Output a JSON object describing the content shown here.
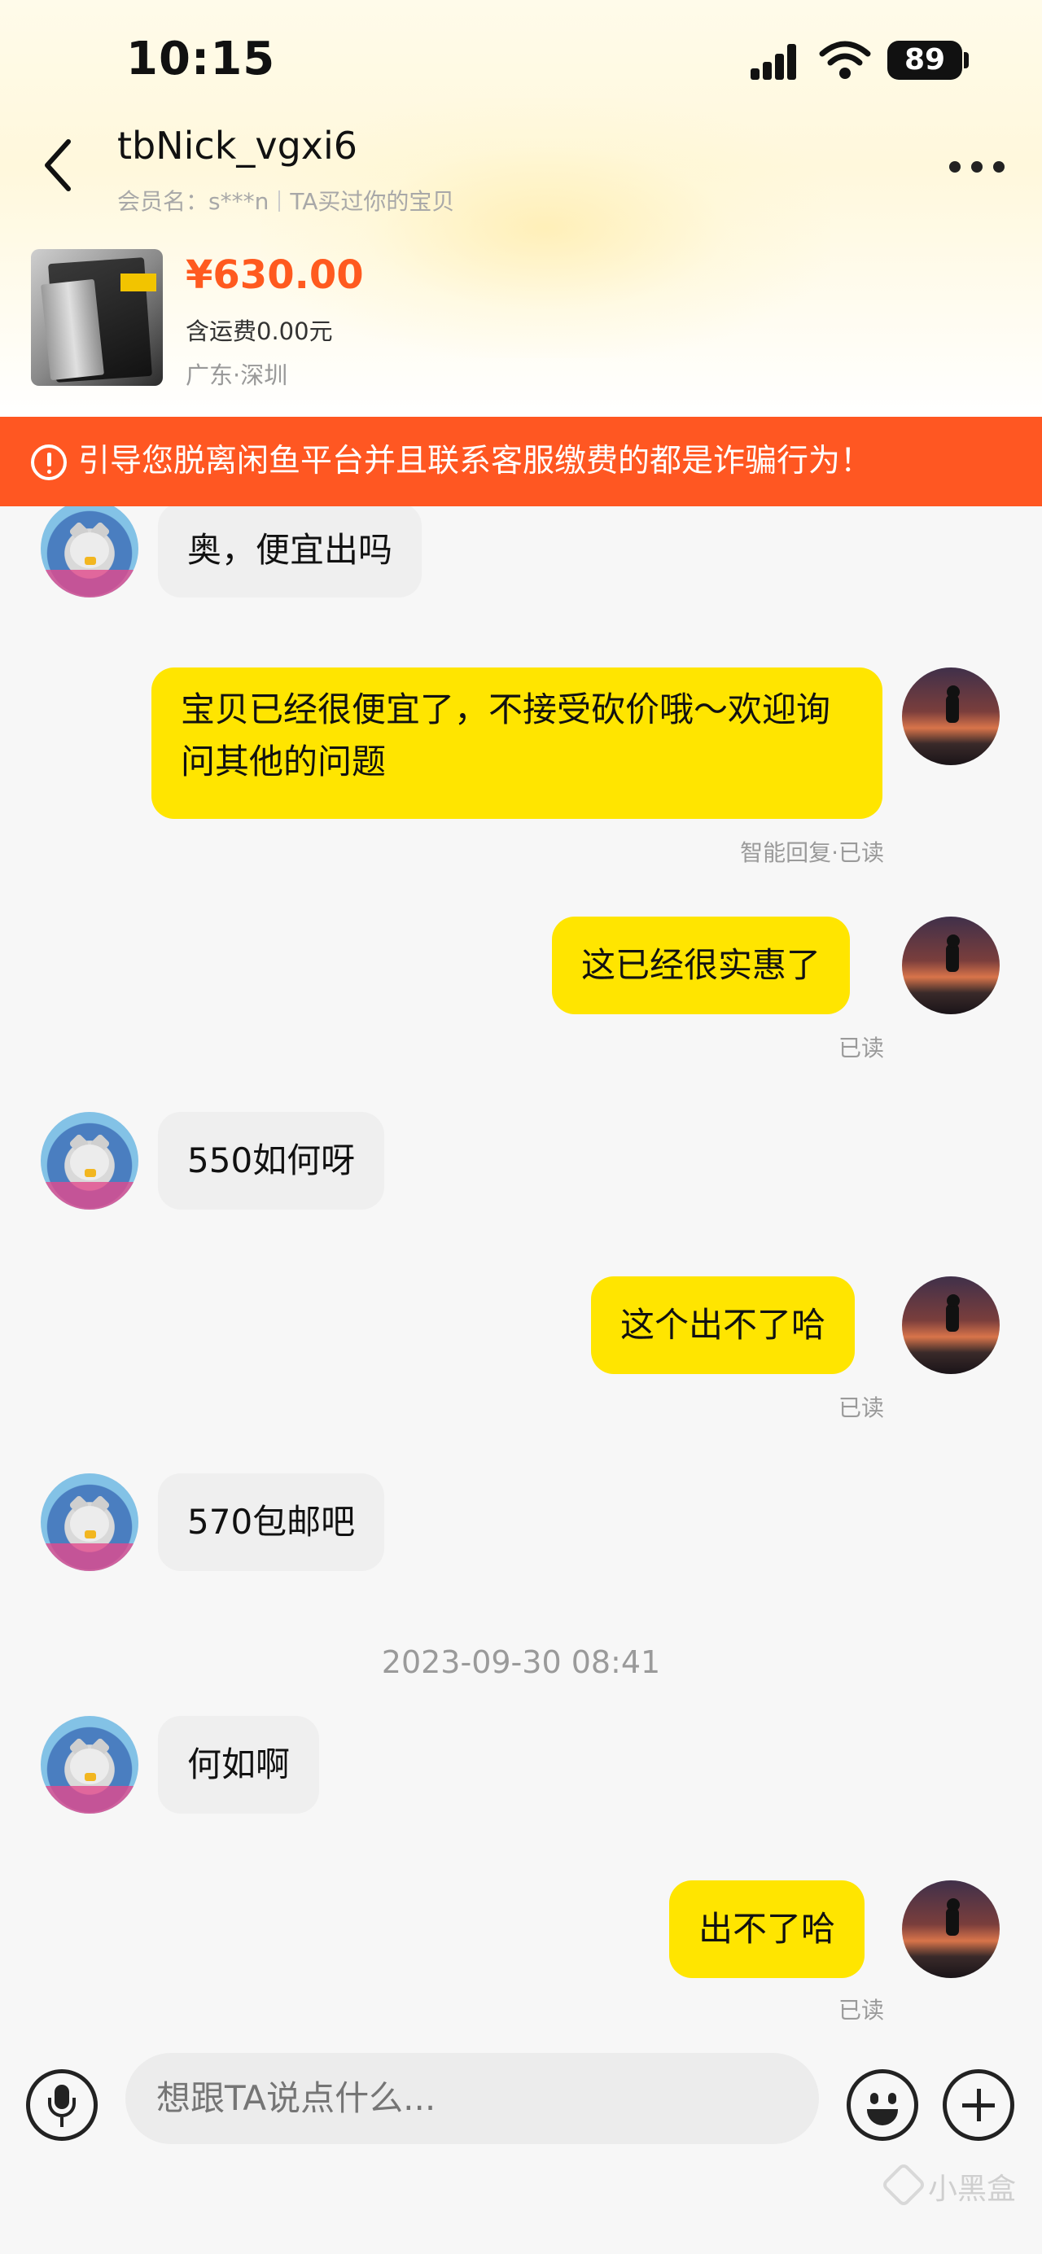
{
  "status_bar": {
    "time": "10:15",
    "battery": "89"
  },
  "header": {
    "nickname": "tbNick_vgxi6",
    "member_name": "会员名：s***n",
    "relation": "TA买过你的宝贝"
  },
  "item": {
    "price": "¥630.00",
    "shipping": "含运费0.00元",
    "location": "广东·深圳"
  },
  "warning_text": "引导您脱离闲鱼平台并且联系客服缴费的都是诈骗行为！",
  "messages": [
    {
      "side": "in",
      "text": "奥，便宜出吗"
    },
    {
      "side": "out",
      "text": "宝贝已经很便宜了，不接受砍价哦～欢迎询问其他的问题",
      "status": "智能回复·已读"
    },
    {
      "side": "out",
      "text": "这已经很实惠了",
      "status": "已读"
    },
    {
      "side": "in",
      "text": "550如何呀"
    },
    {
      "side": "out",
      "text": "这个出不了哈",
      "status": "已读"
    },
    {
      "side": "in",
      "text": "570包邮吧"
    },
    {
      "side": "in",
      "text": "何如啊"
    },
    {
      "side": "out",
      "text": "出不了哈",
      "status": "已读"
    }
  ],
  "timestamp": "2023-09-30 08:41",
  "input": {
    "placeholder": "想跟TA说点什么..."
  },
  "watermark": "小黑盒"
}
